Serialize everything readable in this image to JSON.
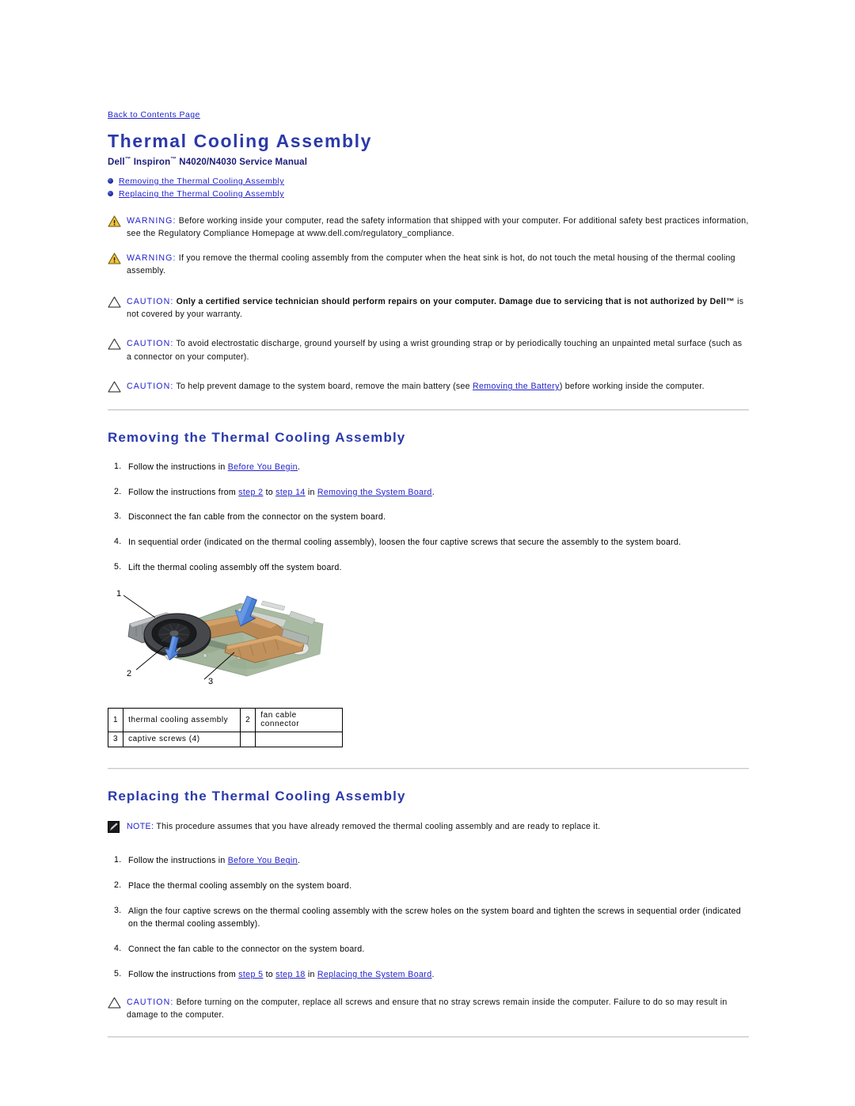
{
  "back_link": "Back to Contents Page",
  "title": "Thermal Cooling Assembly",
  "subtitle_parts": {
    "dell": "Dell",
    "tm1": "™",
    "inspiron": " Inspiron",
    "tm2": "™",
    "model": " N4020/N4030 Service Manual"
  },
  "jumplist": [
    {
      "label": "Removing the Thermal Cooling Assembly",
      "icon": "bullet-icon"
    },
    {
      "label": "Replacing the Thermal Cooling Assembly",
      "icon": "bullet-icon"
    }
  ],
  "admonitions_top": [
    {
      "kind": "warning",
      "icon": "warning-triangle-icon",
      "lead": "WARNING:",
      "text": " Before working inside your computer, read the safety information that shipped with your computer. For additional safety best practices information, see the Regulatory Compliance Homepage at www.dell.com/regulatory_compliance."
    },
    {
      "kind": "warning",
      "icon": "warning-triangle-icon",
      "lead": "WARNING:",
      "text": " If you remove the thermal cooling assembly from the computer when the heat sink is hot, do not touch the metal housing of the thermal cooling assembly."
    },
    {
      "kind": "caution",
      "icon": "caution-triangle-icon",
      "lead": "CAUTION:",
      "bold_text": " Only a certified service technician should perform repairs on your computer. Damage due to servicing that is not authorized by Dell™",
      "text": " is not covered by your warranty."
    },
    {
      "kind": "caution",
      "icon": "caution-triangle-icon",
      "lead": "CAUTION:",
      "text": " To avoid electrostatic discharge, ground yourself by using a wrist grounding strap or by periodically touching an unpainted metal surface (such as a connector on your computer)."
    },
    {
      "kind": "caution",
      "icon": "caution-triangle-icon",
      "lead": "CAUTION:",
      "text_before": " To help prevent damage to the system board, remove the main battery (see ",
      "link": "Removing the Battery",
      "text_after": ") before working inside the computer."
    }
  ],
  "removing": {
    "heading": "Removing the Thermal Cooling Assembly",
    "steps": [
      {
        "num": "1.",
        "text_before": "Follow the instructions in ",
        "link1": "Before You Begin",
        "text_after": "."
      },
      {
        "num": "2.",
        "text_before": "Follow the instructions from ",
        "link1": "step 2",
        "mid1": " to ",
        "link2": "step 14",
        "mid2": " in ",
        "link3": "Removing the System Board",
        "text_after": "."
      },
      {
        "num": "3.",
        "text_plain": "Disconnect the fan cable from the connector on the system board."
      },
      {
        "num": "4.",
        "text_plain": "In sequential order (indicated on the thermal cooling assembly), loosen the four captive screws that secure the assembly to the system board."
      },
      {
        "num": "5.",
        "text_plain": "Lift the thermal cooling assembly off the system board."
      }
    ],
    "figure": {
      "alt": "exploded view of thermal cooling assembly on system board",
      "callouts": [
        "1",
        "2",
        "3"
      ],
      "colors": {
        "pcb": "#9eb39a",
        "pcb_dark": "#7d9479",
        "fan": "#3a3a3a",
        "heatpipe": "#b07a42",
        "arrow": "#3b6fd6",
        "leader": "#000000"
      }
    },
    "legend": {
      "rows": [
        {
          "n1": "1",
          "l1": "thermal cooling assembly",
          "n2": "2",
          "l2": "fan cable connector"
        },
        {
          "n1": "3",
          "l1": "captive screws (4)",
          "n2": "",
          "l2": ""
        }
      ]
    }
  },
  "replacing": {
    "heading": "Replacing the Thermal Cooling Assembly",
    "note": {
      "icon": "note-pencil-icon",
      "lead": "NOTE:",
      "text": " This procedure assumes that you have already removed the thermal cooling assembly and are ready to replace it."
    },
    "steps": [
      {
        "num": "1.",
        "text_before": "Follow the instructions in ",
        "link1": "Before You Begin",
        "text_after": "."
      },
      {
        "num": "2.",
        "text_plain": "Place the thermal cooling assembly on the system board."
      },
      {
        "num": "3.",
        "text_plain": "Align the four captive screws on the thermal cooling assembly with the screw holes on the system board and tighten the screws in sequential order (indicated on the thermal cooling assembly)."
      },
      {
        "num": "4.",
        "text_plain": "Connect the fan cable to the connector on the system board."
      },
      {
        "num": "5.",
        "text_before": "Follow the instructions from ",
        "link1": "step 5",
        "mid1": " to ",
        "link2": "step 18",
        "mid2": " in ",
        "link3": "Replacing the System Board",
        "text_after": "."
      }
    ],
    "final_caution": {
      "kind": "caution",
      "icon": "caution-triangle-icon",
      "lead": "CAUTION:",
      "text": " Before turning on the computer, replace all screws and ensure that no stray screws remain inside the computer. Failure to do so may result in damage to the computer."
    }
  }
}
